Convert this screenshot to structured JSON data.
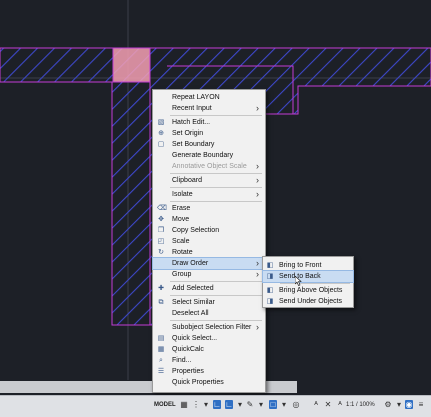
{
  "context_menu": {
    "items": [
      {
        "label": "Repeat LAYON",
        "icon": ""
      },
      {
        "label": "Recent Input",
        "icon": "",
        "submenu": true
      },
      {
        "separator": true
      },
      {
        "label": "Hatch Edit...",
        "icon": "hatch-edit-icon"
      },
      {
        "label": "Set Origin",
        "icon": "origin-icon"
      },
      {
        "label": "Set Boundary",
        "icon": "boundary-icon"
      },
      {
        "label": "Generate Boundary",
        "icon": ""
      },
      {
        "label": "Annotative Object Scale",
        "icon": "",
        "submenu": true,
        "disabled": true
      },
      {
        "separator": true
      },
      {
        "label": "Clipboard",
        "icon": "",
        "submenu": true
      },
      {
        "separator": true
      },
      {
        "label": "Isolate",
        "icon": "",
        "submenu": true
      },
      {
        "separator": true
      },
      {
        "label": "Erase",
        "icon": "erase-icon"
      },
      {
        "label": "Move",
        "icon": "move-icon"
      },
      {
        "label": "Copy Selection",
        "icon": "copy-icon"
      },
      {
        "label": "Scale",
        "icon": "scale-icon"
      },
      {
        "label": "Rotate",
        "icon": "rotate-icon"
      },
      {
        "label": "Draw Order",
        "icon": "",
        "submenu": true,
        "highlighted": true
      },
      {
        "label": "Group",
        "icon": "",
        "submenu": true
      },
      {
        "separator": true
      },
      {
        "label": "Add Selected",
        "icon": "add-selected-icon"
      },
      {
        "separator": true
      },
      {
        "label": "Select Similar",
        "icon": "select-similar-icon"
      },
      {
        "label": "Deselect All",
        "icon": ""
      },
      {
        "separator": true
      },
      {
        "label": "Subobject Selection Filter",
        "icon": "",
        "submenu": true
      },
      {
        "label": "Quick Select...",
        "icon": "quick-select-icon"
      },
      {
        "label": "QuickCalc",
        "icon": "calculator-icon"
      },
      {
        "label": "Find...",
        "icon": "find-icon"
      },
      {
        "label": "Properties",
        "icon": "properties-icon"
      },
      {
        "label": "Quick Properties",
        "icon": ""
      }
    ]
  },
  "draw_order_submenu": {
    "items": [
      {
        "label": "Bring to Front",
        "icon": "bring-to-front-icon"
      },
      {
        "label": "Send to Back",
        "icon": "send-to-back-icon",
        "highlighted": true
      },
      {
        "separator": true
      },
      {
        "label": "Bring Above Objects",
        "icon": "bring-above-icon"
      },
      {
        "label": "Send Under Objects",
        "icon": "send-under-icon"
      }
    ]
  },
  "status_bar": {
    "model_label": "MODEL",
    "scale_label": "1:1 / 100%",
    "icons": [
      "grid-icon",
      "snap-icon",
      "ortho-icon",
      "polar-icon",
      "osnap-icon",
      "lineweight-icon",
      "annotation-icon",
      "gear-icon",
      "customize-icon"
    ]
  },
  "colors": {
    "canvas_bg": "#1d2027",
    "hatch_boundary": "#c23bd4",
    "hatch_lines": "#3d47c9",
    "highlight_fill": "#f4a0b4",
    "menu_bg": "#f1f1f1",
    "menu_highlight": "#c9dcf2"
  }
}
